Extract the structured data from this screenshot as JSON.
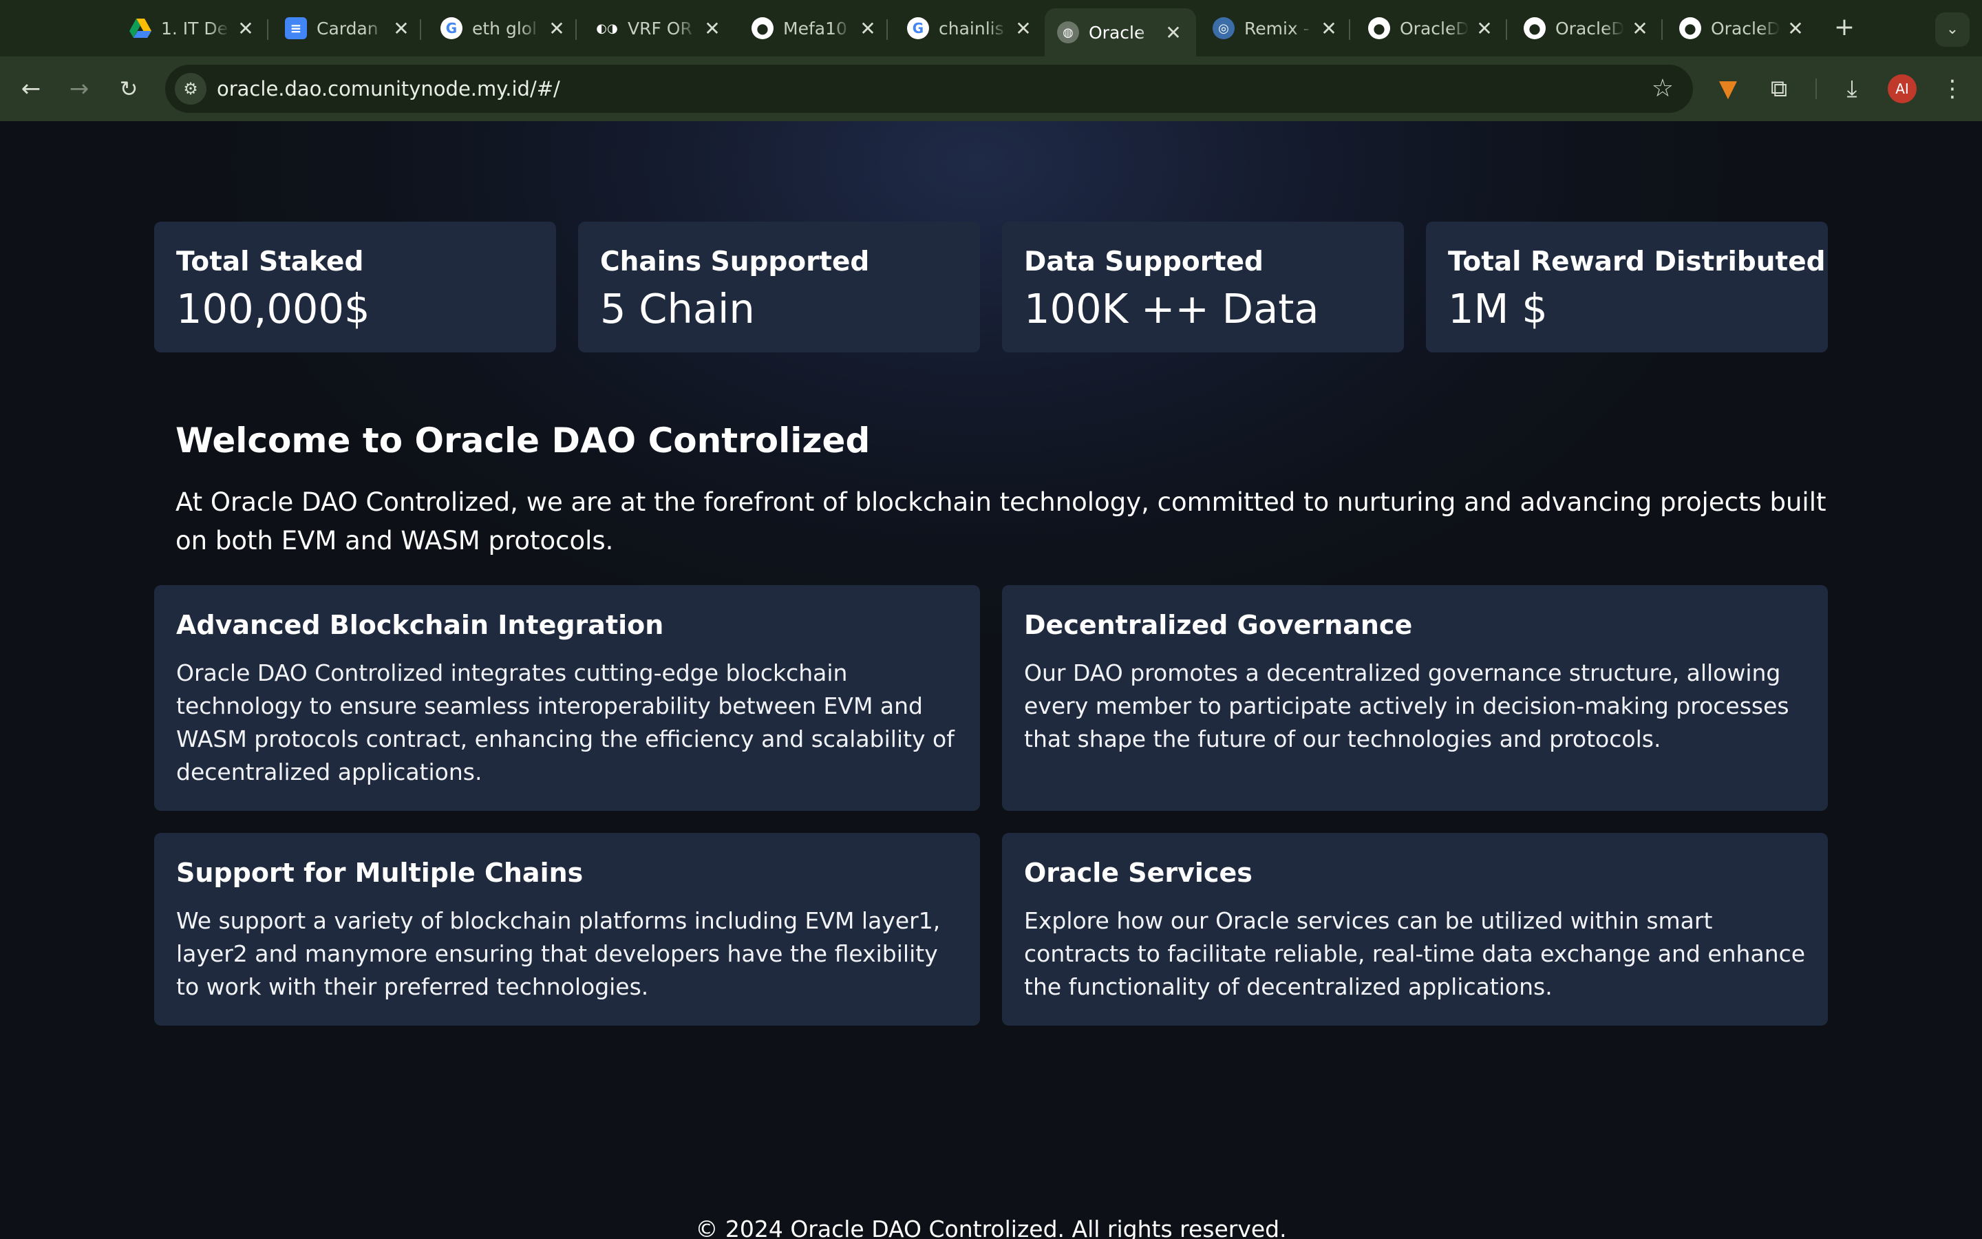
{
  "browser": {
    "tabs": [
      {
        "title": "1. IT De",
        "icon": "google-drive-icon"
      },
      {
        "title": "Cardan",
        "icon": "google-docs-icon"
      },
      {
        "title": "eth glol",
        "icon": "google-icon"
      },
      {
        "title": "VRF OR",
        "icon": "vrf-icon"
      },
      {
        "title": "Mefa10",
        "icon": "github-icon"
      },
      {
        "title": "chainlis",
        "icon": "google-icon"
      },
      {
        "title": "Oracle",
        "icon": "globe-icon",
        "active": true
      },
      {
        "title": "Remix -",
        "icon": "remix-icon"
      },
      {
        "title": "OracleD",
        "icon": "github-icon"
      },
      {
        "title": "OracleD",
        "icon": "github-icon"
      },
      {
        "title": "OracleD",
        "icon": "github-icon"
      }
    ],
    "url": "oracle.dao.comunitynode.my.id/#/",
    "avatar_initials": "AI"
  },
  "stats": [
    {
      "label": "Total Staked",
      "value": "100,000$"
    },
    {
      "label": "Chains Supported",
      "value": "5 Chain"
    },
    {
      "label": "Data Supported",
      "value": "100K ++ Data"
    },
    {
      "label": "Total Reward Distributed",
      "value": "1M $"
    }
  ],
  "welcome": {
    "title": "Welcome to Oracle DAO Controlized",
    "text": "At Oracle DAO Controlized, we are at the forefront of blockchain technology, committed to nurturing and advancing projects built on both EVM and WASM protocols."
  },
  "features": [
    {
      "title": "Advanced Blockchain Integration",
      "text": "Oracle DAO Controlized integrates cutting-edge blockchain technology to ensure seamless interoperability between EVM and WASM protocols contract, enhancing the efficiency and scalability of decentralized applications."
    },
    {
      "title": "Decentralized Governance",
      "text": "Our DAO promotes a decentralized governance structure, allowing every member to participate actively in decision-making processes that shape the future of our technologies and protocols."
    },
    {
      "title": "Support for Multiple Chains",
      "text": "We support a variety of blockchain platforms including EVM layer1, layer2 and manymore ensuring that developers have the flexibility to work with their preferred technologies."
    },
    {
      "title": "Oracle Services",
      "text": "Explore how our Oracle services can be utilized within smart contracts to facilitate reliable, real-time data exchange and enhance the functionality of decentralized applications."
    }
  ],
  "footer": "© 2024 Oracle DAO Controlized. All rights reserved."
}
